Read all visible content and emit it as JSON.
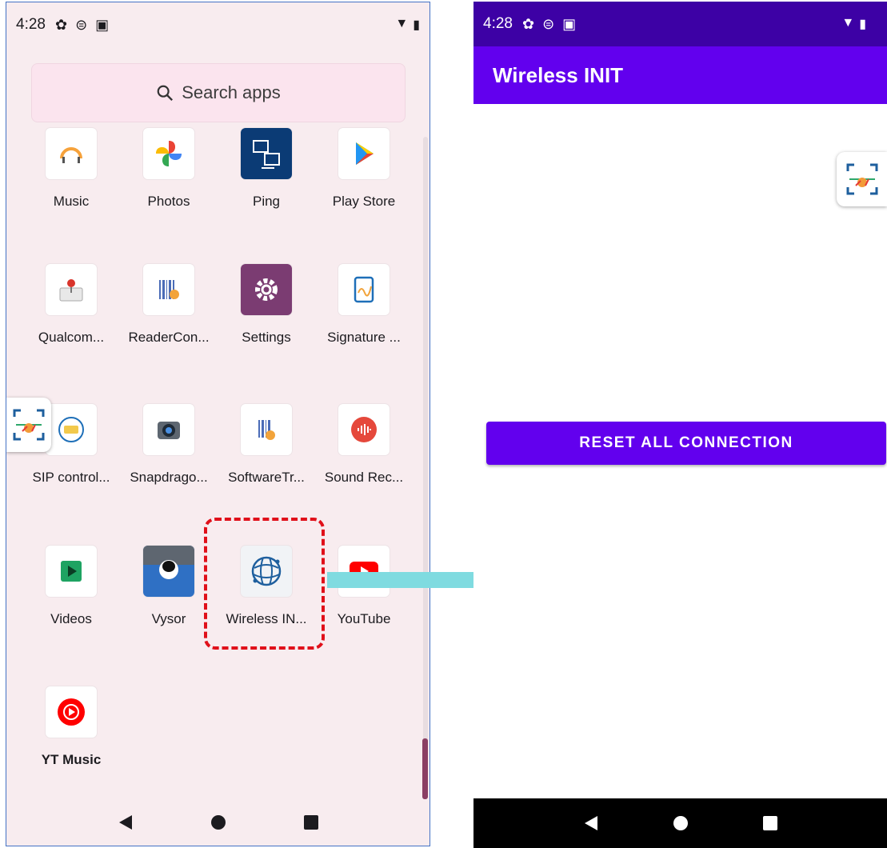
{
  "left_screen": {
    "status": {
      "time": "4:28"
    },
    "search": {
      "label": "Search apps"
    },
    "apps": [
      {
        "label": "Music"
      },
      {
        "label": "Photos"
      },
      {
        "label": "Ping"
      },
      {
        "label": "Play Store"
      },
      {
        "label": "Qualcom..."
      },
      {
        "label": "ReaderCon..."
      },
      {
        "label": "Settings"
      },
      {
        "label": "Signature ..."
      },
      {
        "label": "SIP control..."
      },
      {
        "label": "Snapdrago..."
      },
      {
        "label": "SoftwareTr..."
      },
      {
        "label": "Sound Rec..."
      },
      {
        "label": "Videos"
      },
      {
        "label": "Vysor"
      },
      {
        "label": "Wireless IN..."
      },
      {
        "label": "YouTube"
      },
      {
        "label": "YT Music"
      }
    ]
  },
  "right_screen": {
    "status": {
      "time": "4:28"
    },
    "app_title": "Wireless INIT",
    "reset_button_label": "RESET ALL CONNECTION"
  },
  "colors": {
    "accent": "#6200ee",
    "status_bar_dark": "#3d01a5",
    "highlight": "#e0101a",
    "arrow": "#7fdbe0"
  }
}
